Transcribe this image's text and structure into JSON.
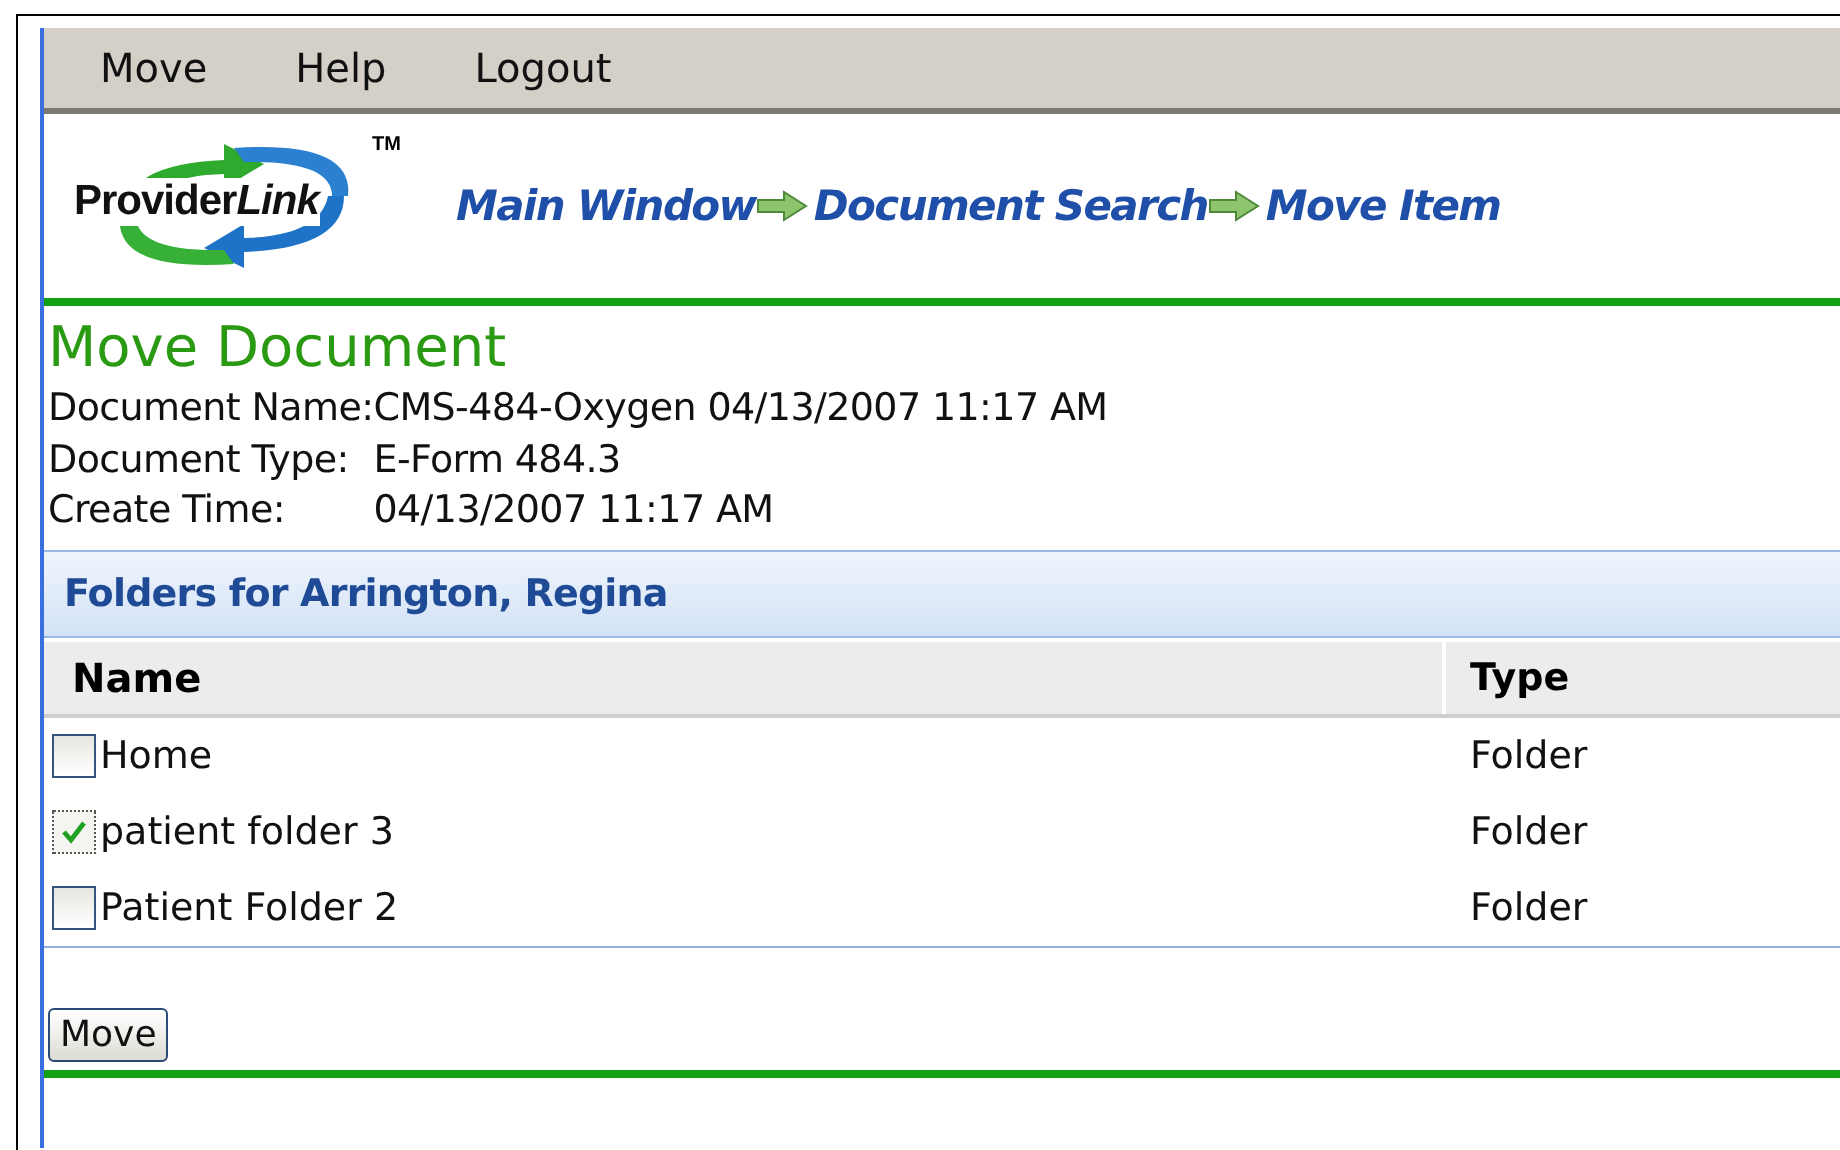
{
  "menu": [
    {
      "label": "Move"
    },
    {
      "label": "Help"
    },
    {
      "label": "Logout"
    }
  ],
  "logo": {
    "text": "Provider",
    "emphasis": "Link",
    "mark": "TM"
  },
  "breadcrumb": [
    {
      "label": "Main Window"
    },
    {
      "label": "Document Search"
    },
    {
      "label": "Move Item"
    }
  ],
  "title": "Move Document",
  "details": [
    {
      "label": "Document Name:",
      "value": "CMS-484-Oxygen 04/13/2007 11:17 AM"
    },
    {
      "label": "Document Type:",
      "value": "E-Form 484.3"
    },
    {
      "label": "Create Time:",
      "value": "04/13/2007 11:17 AM"
    }
  ],
  "panel": {
    "title": "Folders for Arrington, Regina",
    "columns": [
      "Name",
      "Type"
    ],
    "rows": [
      {
        "name": "Home",
        "type": "Folder",
        "checked": false
      },
      {
        "name": "patient folder 3",
        "type": "Folder",
        "checked": true
      },
      {
        "name": "Patient Folder 2",
        "type": "Folder",
        "checked": false
      }
    ]
  },
  "button": "Move"
}
